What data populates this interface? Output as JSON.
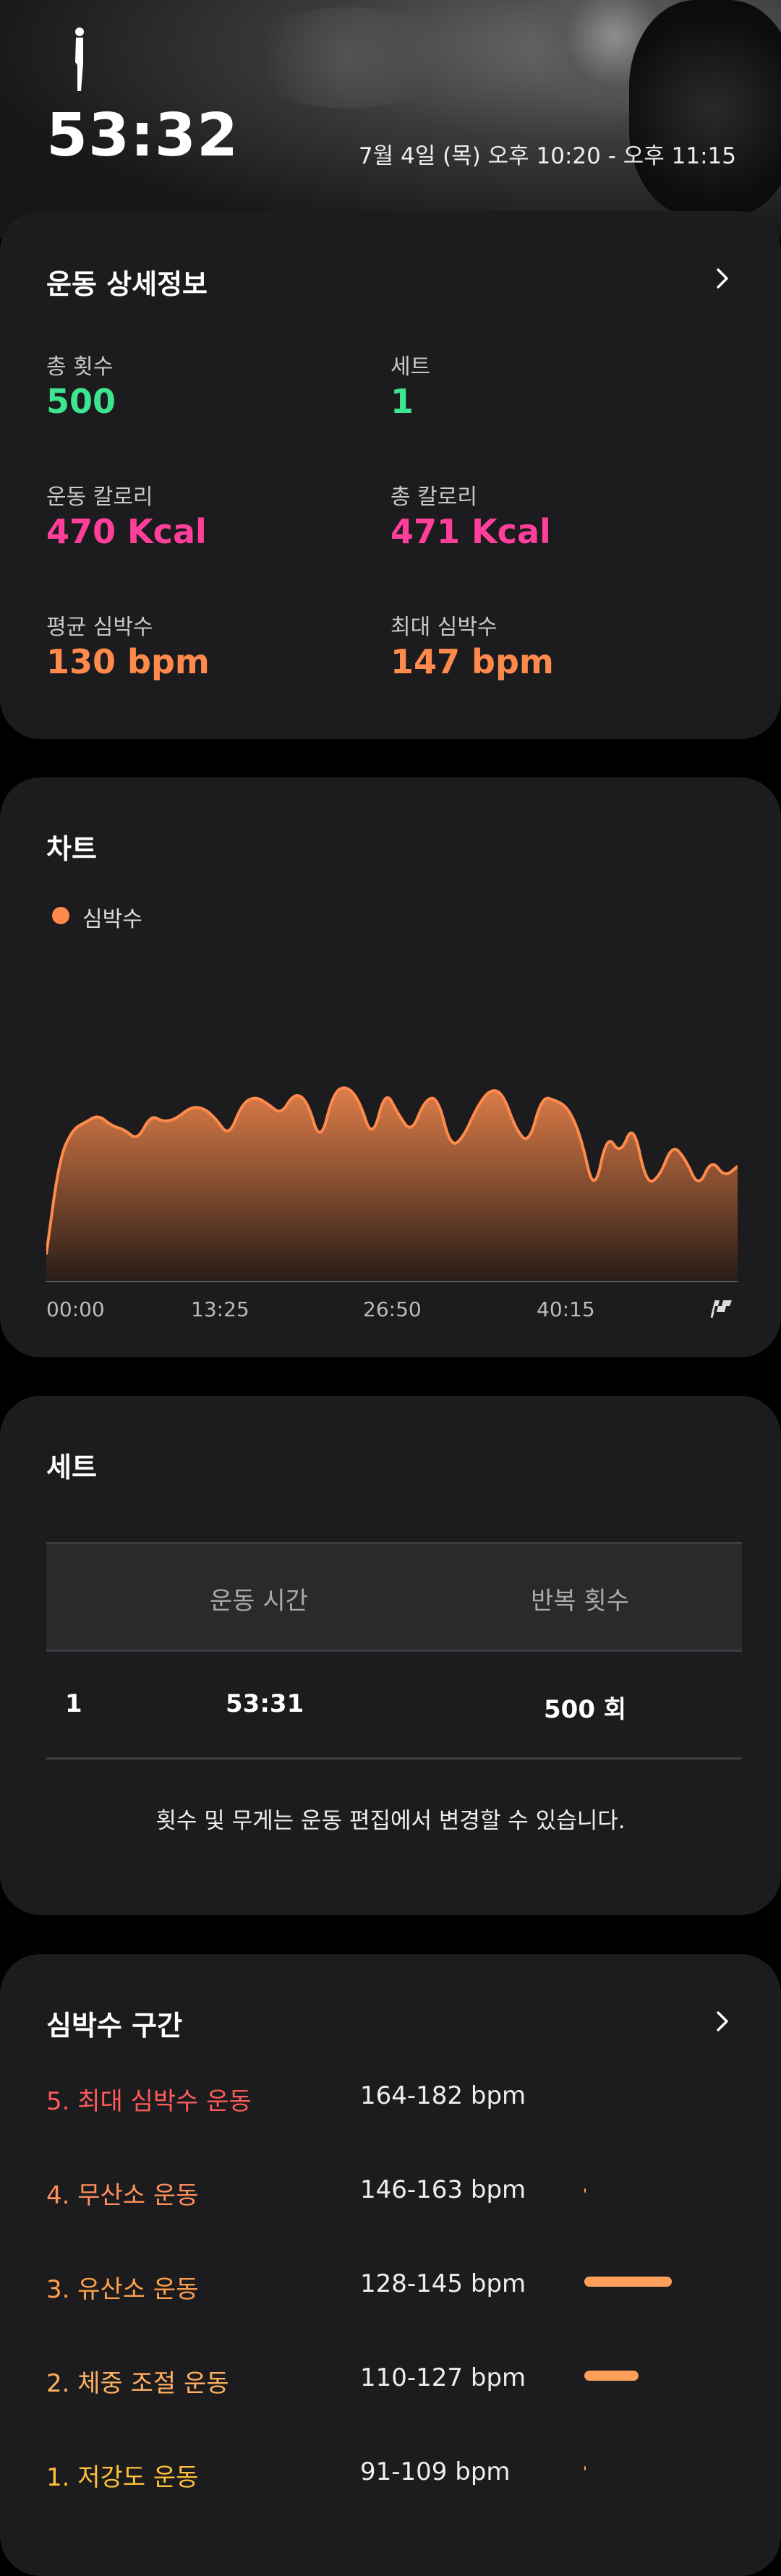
{
  "header": {
    "duration": "53:32",
    "time_range": "7월 4일 (목) 오후 10:20 - 오후 11:15",
    "workout_icon": "standing-figure-icon"
  },
  "details": {
    "title": "운동 상세정보",
    "stats": [
      {
        "label": "총 횟수",
        "value": "500",
        "color": "#3ee58f"
      },
      {
        "label": "세트",
        "value": "1",
        "color": "#3ee58f"
      },
      {
        "label": "운동 칼로리",
        "value": "470 Kcal",
        "color": "#ff3f9a"
      },
      {
        "label": "총 칼로리",
        "value": "471 Kcal",
        "color": "#ff3f9a"
      },
      {
        "label": "평균 심박수",
        "value": "130 bpm",
        "color": "#ff8a4c"
      },
      {
        "label": "최대 심박수",
        "value": "147 bpm",
        "color": "#ff8a4c"
      }
    ]
  },
  "chart": {
    "title": "차트",
    "legend": "심박수",
    "finish_icon": "checkered-flag-icon"
  },
  "chart_data": {
    "type": "area",
    "series": [
      {
        "name": "심박수",
        "color": "#ff8a4c"
      }
    ],
    "x_ticks": [
      "00:00",
      "13:25",
      "26:50",
      "40:15"
    ],
    "x": [
      0,
      1,
      2,
      3,
      4,
      5,
      6,
      7,
      8,
      9,
      10,
      11,
      12,
      13,
      14,
      15,
      16,
      17,
      18,
      19,
      20,
      21,
      22,
      23,
      24,
      25,
      26,
      27,
      28,
      29,
      30,
      31,
      32,
      33,
      34,
      35,
      36,
      37,
      38,
      39,
      40,
      41,
      42,
      43,
      44,
      45,
      46,
      47,
      48,
      49,
      50,
      51,
      52,
      53
    ],
    "values": [
      92,
      118,
      126,
      128,
      130,
      127,
      126,
      123,
      130,
      128,
      129,
      132,
      132,
      129,
      124,
      133,
      135,
      133,
      130,
      136,
      134,
      122,
      136,
      138,
      134,
      123,
      137,
      130,
      125,
      134,
      135,
      121,
      124,
      132,
      137,
      136,
      126,
      122,
      135,
      134,
      132,
      124,
      108,
      125,
      119,
      128,
      111,
      113,
      122,
      118,
      110,
      118,
      113,
      116
    ],
    "ylim": [
      85,
      150
    ],
    "grid": false
  },
  "sets": {
    "title": "세트",
    "headers": [
      "운동 시간",
      "반복 횟수"
    ],
    "rows": [
      {
        "index": "1",
        "time": "53:31",
        "reps": "500 회"
      }
    ],
    "note": "횟수 및 무게는 운동 편집에서 변경할 수 있습니다."
  },
  "zones": {
    "title": "심박수 구간",
    "items": [
      {
        "name": "5. 최대 심박수 운동",
        "range": "164-182 bpm",
        "color": "#ff5a5a",
        "share": 0.0
      },
      {
        "name": "4. 무산소 운동",
        "range": "146-163 bpm",
        "color": "#ff8f5a",
        "share": 0.01
      },
      {
        "name": "3. 유산소 운동",
        "range": "128-145 bpm",
        "color": "#ffa04c",
        "share": 0.55
      },
      {
        "name": "2. 체중 조절 운동",
        "range": "110-127 bpm",
        "color": "#ffb060",
        "share": 0.34
      },
      {
        "name": "1. 저강도 운동",
        "range": "91-109 bpm",
        "color": "#ffc03a",
        "share": 0.01
      }
    ]
  }
}
